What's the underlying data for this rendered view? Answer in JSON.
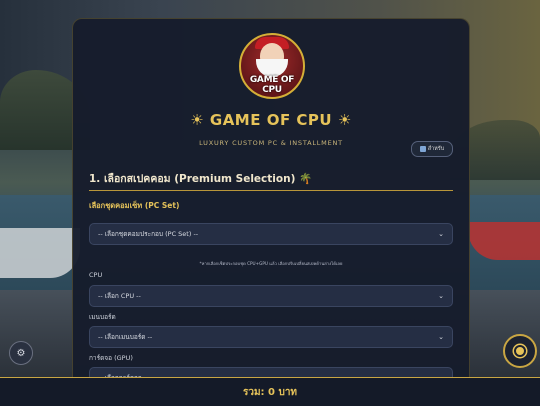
{
  "brand": {
    "logo_text": "GAME OF CPU",
    "title": "GAME OF CPU",
    "subtitle": "LUXURY CUSTOM PC & INSTALLMENT"
  },
  "guide_button": {
    "label": "สำหรับ"
  },
  "section": {
    "heading": "1. เลือกสเปคคอม (Premium Selection)"
  },
  "pc_set": {
    "label": "เลือกชุดคอมเซ็ท (PC Set)",
    "value": "-- เลือกชุดคอมประกอบ (PC Set) --",
    "note": "*หากเลือกเซ็ตประกอบชุด CPU+GPU แล้ว เลือกปรับเปลี่ยนสเปคด้านล่างได้เลย"
  },
  "fields": [
    {
      "label": "CPU",
      "value": "-- เลือก CPU --"
    },
    {
      "label": "เมนบอร์ด",
      "value": "-- เลือกเมนบอร์ด --"
    },
    {
      "label": "การ์ดจอ (GPU)",
      "value": "-- เลือกการ์ดจอ --"
    }
  ],
  "footer": {
    "total": "รวม: 0 บาท"
  },
  "colors": {
    "accent": "#e6c35a",
    "card": "#161c2c",
    "border": "#c9a643"
  },
  "icons": {
    "guide": "book-icon",
    "left_float": "gear-icon",
    "right_float": "record-icon",
    "title_deco": "sun-icon",
    "section_deco": "palm-tree-icon",
    "select": "chevron-down-icon"
  }
}
